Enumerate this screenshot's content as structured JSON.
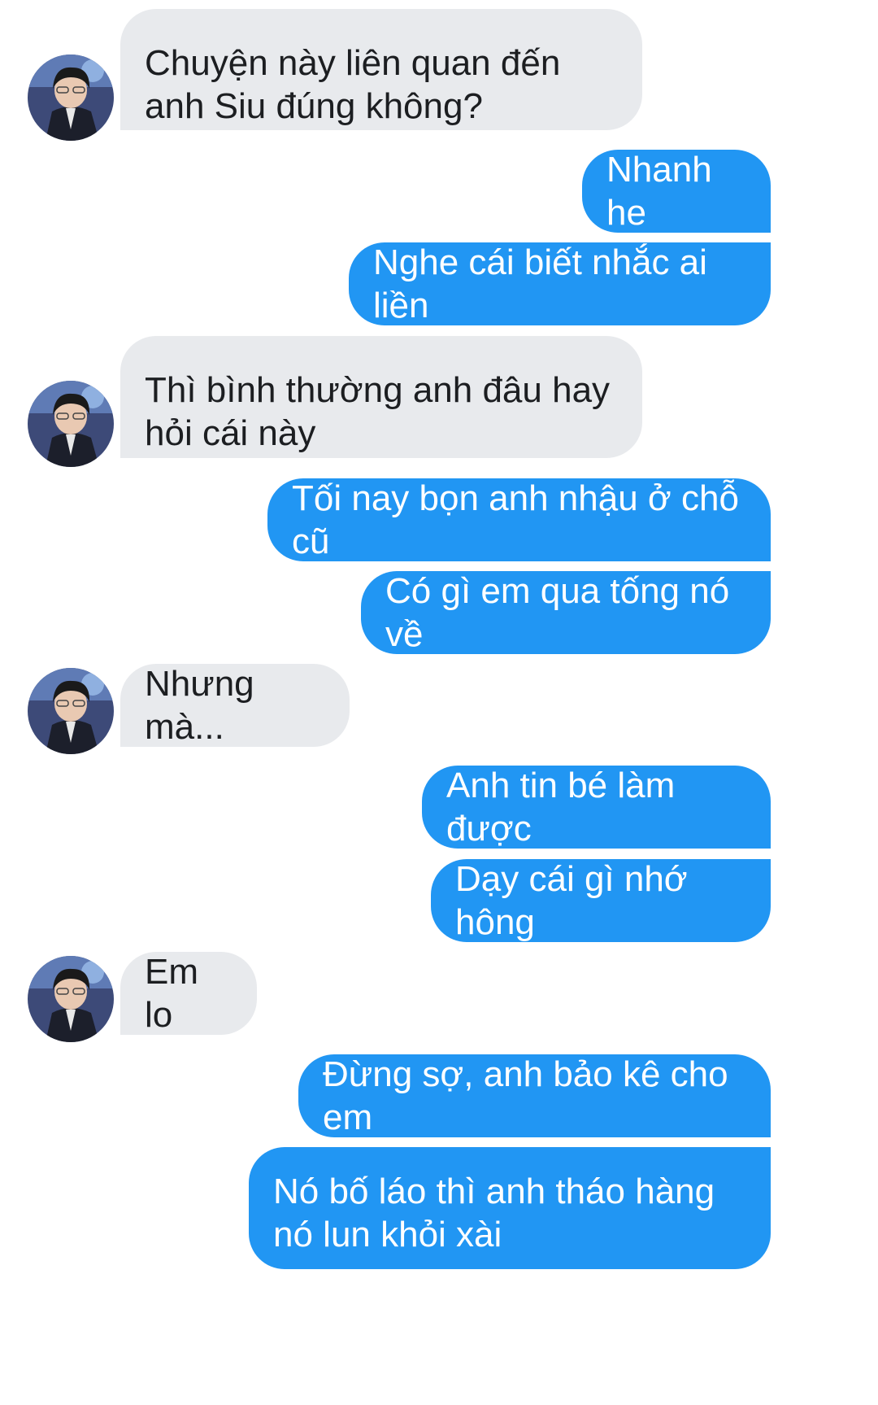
{
  "conversation": {
    "messages": [
      {
        "sender": "other",
        "text": "Chuyện này liên quan đến anh Siu đúng không?"
      },
      {
        "sender": "me",
        "text": "Nhanh he"
      },
      {
        "sender": "me",
        "text": "Nghe cái biết nhắc ai liền"
      },
      {
        "sender": "other",
        "text": "Thì bình thường anh đâu hay hỏi cái này"
      },
      {
        "sender": "me",
        "text": "Tối nay bọn anh nhậu ở chỗ cũ"
      },
      {
        "sender": "me",
        "text": "Có gì em qua tống nó về"
      },
      {
        "sender": "other",
        "text": "Nhưng mà..."
      },
      {
        "sender": "me",
        "text": "Anh tin bé làm được"
      },
      {
        "sender": "me",
        "text": "Dạy cái gì nhớ hông"
      },
      {
        "sender": "other",
        "text": "Em lo"
      },
      {
        "sender": "me",
        "text": "Đừng sợ, anh bảo kê cho em"
      },
      {
        "sender": "me",
        "text": "Nó bố láo thì anh tháo hàng nó lun khỏi xài"
      }
    ]
  },
  "avatar": {
    "icon": "person-in-suit-avatar-icon"
  },
  "colors": {
    "outgoing_bubble": "#2196f3",
    "incoming_bubble": "#e8eaed",
    "outgoing_text": "#ffffff",
    "incoming_text": "#1c1e21"
  }
}
